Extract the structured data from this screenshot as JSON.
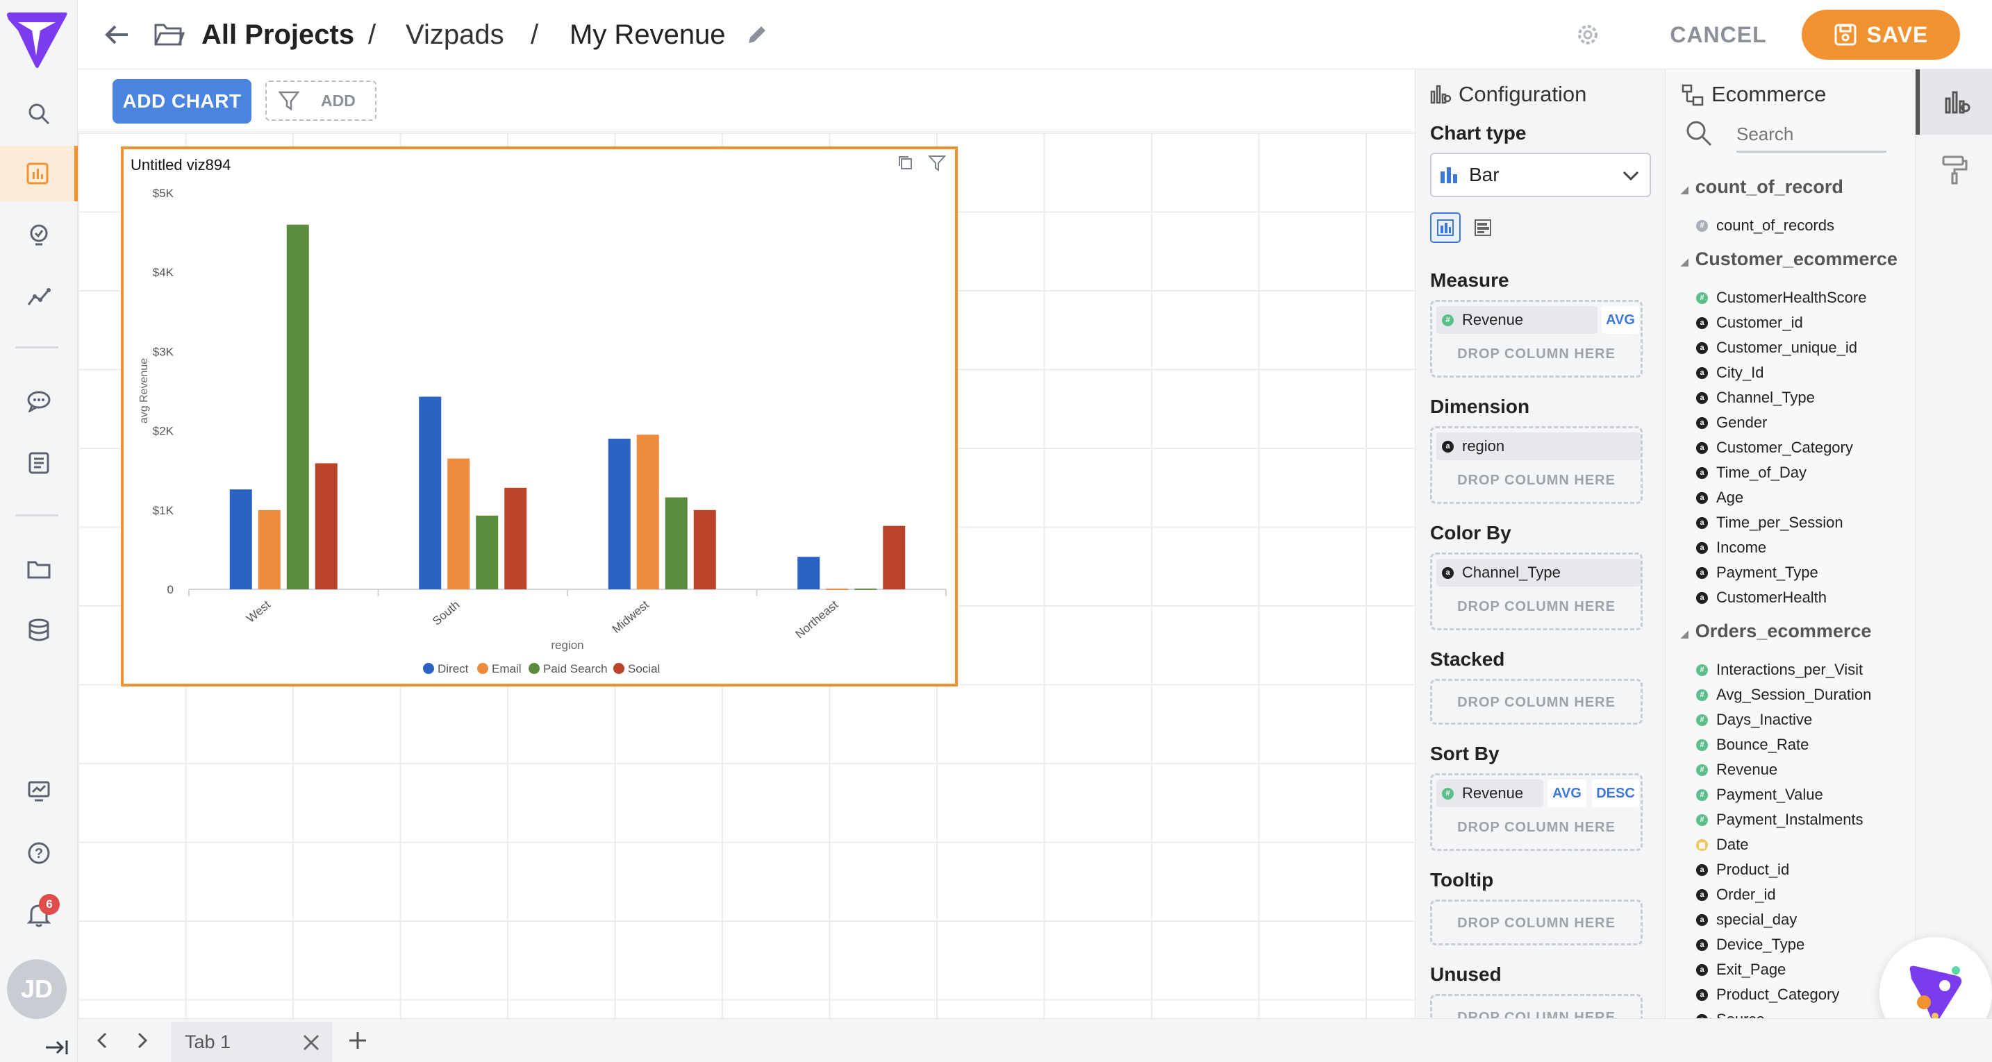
{
  "nav": {
    "items": [
      "search",
      "charts",
      "insights",
      "analytics",
      "chat",
      "docs",
      "projects",
      "datasets",
      "monitor",
      "help",
      "notifications"
    ],
    "notification_count": "6",
    "avatar_initials": "JD"
  },
  "header": {
    "breadcrumb_root": "All Projects",
    "breadcrumb_sep": "/",
    "breadcrumb_mid": "Vizpads",
    "title": "My Revenue",
    "cancel_label": "CANCEL",
    "save_label": "SAVE"
  },
  "toolbar": {
    "add_chart_label": "ADD CHART",
    "add_filter_label": "ADD"
  },
  "viz": {
    "title": "Untitled viz894"
  },
  "chart_data": {
    "type": "bar",
    "categories": [
      "West",
      "South",
      "Midwest",
      "Northeast"
    ],
    "series": [
      {
        "name": "Direct",
        "values": [
          1260,
          2430,
          1900,
          410
        ]
      },
      {
        "name": "Email",
        "values": [
          1000,
          1650,
          1950,
          10
        ]
      },
      {
        "name": "Paid Search",
        "values": [
          4600,
          930,
          1160,
          10
        ]
      },
      {
        "name": "Social",
        "values": [
          1590,
          1280,
          1000,
          800
        ]
      }
    ],
    "colors": [
      "#2a63c2",
      "#ec8a3d",
      "#5b8b3c",
      "#b9432b"
    ],
    "xlabel": "region",
    "ylabel": "avg Revenue",
    "ylim": [
      0,
      5000
    ],
    "yticks": [
      "0",
      "$1K",
      "$2K",
      "$3K",
      "$4K",
      "$5K"
    ],
    "legend": "bottom",
    "grid": false
  },
  "config": {
    "title": "Configuration",
    "chart_type_label": "Chart type",
    "chart_type_value": "Bar",
    "measure_label": "Measure",
    "measure_field": "Revenue",
    "measure_agg": "AVG",
    "dimension_label": "Dimension",
    "dimension_field": "region",
    "colorby_label": "Color By",
    "colorby_field": "Channel_Type",
    "stacked_label": "Stacked",
    "sortby_label": "Sort By",
    "sortby_field": "Revenue",
    "sortby_agg": "AVG",
    "sortby_dir": "DESC",
    "tooltip_label": "Tooltip",
    "unused_label": "Unused",
    "drop_text": "DROP COLUMN HERE"
  },
  "data_panel": {
    "title": "Ecommerce",
    "search_placeholder": "Search",
    "groups": [
      {
        "name": "count_of_record",
        "fields": [
          {
            "n": "count_of_records",
            "t": "count"
          }
        ]
      },
      {
        "name": "Customer_ecommerce",
        "fields": [
          {
            "n": "CustomerHealthScore",
            "t": "num"
          },
          {
            "n": "Customer_id",
            "t": "str"
          },
          {
            "n": "Customer_unique_id",
            "t": "str"
          },
          {
            "n": "City_Id",
            "t": "str"
          },
          {
            "n": "Channel_Type",
            "t": "str"
          },
          {
            "n": "Gender",
            "t": "str"
          },
          {
            "n": "Customer_Category",
            "t": "str"
          },
          {
            "n": "Time_of_Day",
            "t": "str"
          },
          {
            "n": "Age",
            "t": "str"
          },
          {
            "n": "Time_per_Session",
            "t": "str"
          },
          {
            "n": "Income",
            "t": "str"
          },
          {
            "n": "Payment_Type",
            "t": "str"
          },
          {
            "n": "CustomerHealth",
            "t": "str"
          }
        ]
      },
      {
        "name": "Orders_ecommerce",
        "fields": [
          {
            "n": "Interactions_per_Visit",
            "t": "num"
          },
          {
            "n": "Avg_Session_Duration",
            "t": "num"
          },
          {
            "n": "Days_Inactive",
            "t": "num"
          },
          {
            "n": "Bounce_Rate",
            "t": "num"
          },
          {
            "n": "Revenue",
            "t": "num"
          },
          {
            "n": "Payment_Value",
            "t": "num"
          },
          {
            "n": "Payment_Instalments",
            "t": "num"
          },
          {
            "n": "Date",
            "t": "date"
          },
          {
            "n": "Product_id",
            "t": "str"
          },
          {
            "n": "Order_id",
            "t": "str"
          },
          {
            "n": "special_day",
            "t": "str"
          },
          {
            "n": "Device_Type",
            "t": "str"
          },
          {
            "n": "Exit_Page",
            "t": "str"
          },
          {
            "n": "Product_Category",
            "t": "str"
          },
          {
            "n": "Source",
            "t": "str"
          }
        ]
      }
    ]
  },
  "tabs": {
    "items": [
      "Tab 1"
    ]
  }
}
